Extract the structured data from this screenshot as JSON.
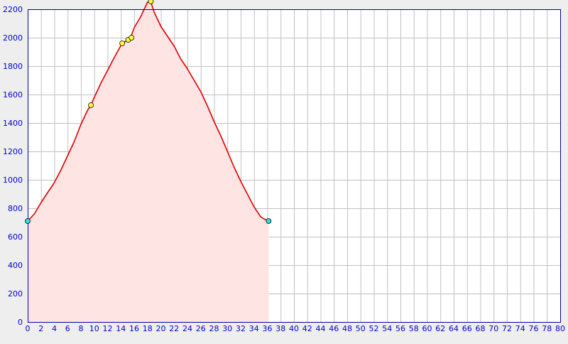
{
  "chart_data": {
    "type": "area",
    "title": "",
    "xlabel": "",
    "ylabel": "",
    "xlim": [
      0,
      80
    ],
    "ylim": [
      0,
      2200
    ],
    "x_ticks": [
      0,
      2,
      4,
      6,
      8,
      10,
      12,
      14,
      16,
      18,
      20,
      22,
      24,
      26,
      28,
      30,
      32,
      34,
      36,
      38,
      40,
      42,
      44,
      46,
      48,
      50,
      52,
      54,
      56,
      58,
      60,
      62,
      64,
      66,
      68,
      70,
      72,
      74,
      76,
      78,
      80
    ],
    "y_ticks": [
      0,
      200,
      400,
      600,
      800,
      1000,
      1200,
      1400,
      1600,
      1800,
      2000,
      2200
    ],
    "grid": true,
    "legend": "none",
    "series": [
      {
        "x": [
          0,
          1,
          2,
          3,
          4,
          5,
          6,
          7,
          8,
          9,
          9.5,
          10,
          11,
          12,
          13,
          14,
          14.3,
          15,
          15.5,
          16,
          17,
          17.5,
          18,
          18.5,
          19,
          20,
          21,
          22,
          23,
          24,
          25,
          26,
          27,
          28,
          29,
          30,
          31,
          32,
          33,
          34,
          35,
          35.5,
          36.2
        ],
        "y": [
          710,
          760,
          840,
          910,
          980,
          1070,
          1170,
          1270,
          1390,
          1490,
          1525,
          1580,
          1680,
          1770,
          1860,
          1945,
          1960,
          1985,
          2005,
          2070,
          2150,
          2200,
          2250,
          2250,
          2180,
          2080,
          2010,
          1940,
          1850,
          1780,
          1700,
          1620,
          1520,
          1410,
          1310,
          1200,
          1090,
          990,
          900,
          810,
          740,
          725,
          710
        ]
      }
    ],
    "markers": [
      {
        "x": 0,
        "y": 710,
        "kind": "endpoint"
      },
      {
        "x": 9.5,
        "y": 1525,
        "kind": "waypoint"
      },
      {
        "x": 14.2,
        "y": 1960,
        "kind": "waypoint"
      },
      {
        "x": 15.1,
        "y": 1985,
        "kind": "waypoint"
      },
      {
        "x": 15.6,
        "y": 2000,
        "kind": "waypoint"
      },
      {
        "x": 18.5,
        "y": 2255,
        "kind": "waypoint"
      },
      {
        "x": 36.2,
        "y": 710,
        "kind": "endpoint"
      }
    ],
    "colors": {
      "line": "#dd0000",
      "fill": "#ffe4e4",
      "grid": "#c0c0c0",
      "axis": "#0000aa",
      "tick_label": "#0000cc",
      "waypoint": "#ffff33",
      "endpoint": "#33dddd",
      "plot_bg": "#ffffff",
      "page_bg": "#eeeeee"
    }
  }
}
